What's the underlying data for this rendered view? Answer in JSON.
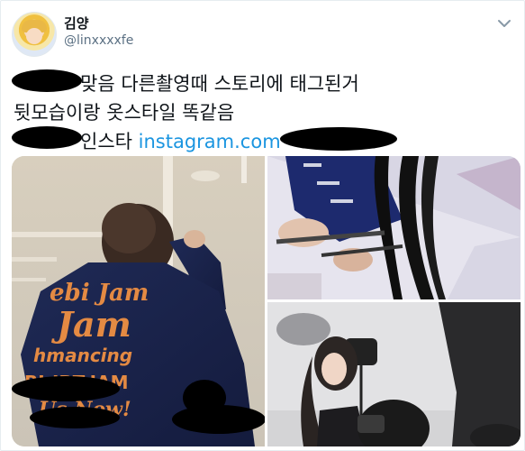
{
  "tweet": {
    "display_name": "김양",
    "handle": "@linxxxxfe",
    "line1": "맞음 다른촬영때 스토리에 태그된거",
    "line2": "뒷모습이랑 옷스타일 똑같음",
    "line3_text": "인스타",
    "line3_link": "instagram.com",
    "photo1_sweatshirt_text": [
      "ebi Jam",
      "Jam",
      "hmancing",
      "BI-JBT-JAM",
      "Us Now!"
    ]
  }
}
